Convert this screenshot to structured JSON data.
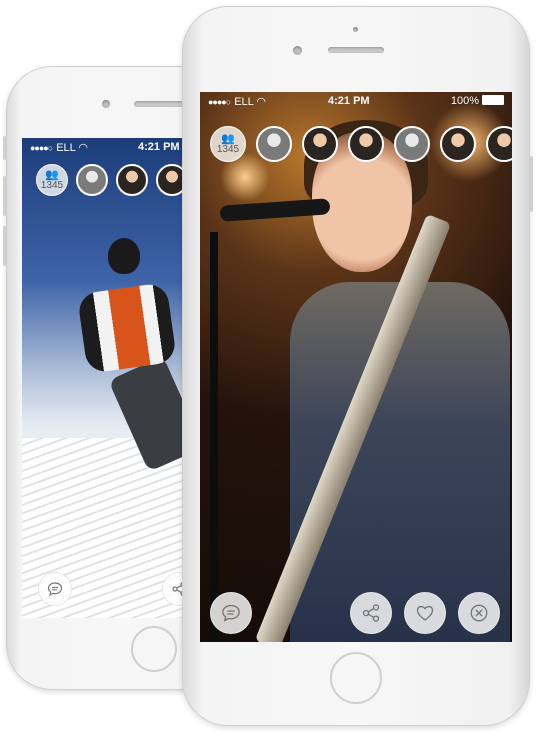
{
  "back_phone": {
    "status": {
      "carrier": "ELL",
      "time": "4:21 PM"
    },
    "viewers": {
      "count": "1345",
      "icon": "group-icon"
    },
    "avatars": [
      "avatar-1",
      "avatar-2",
      "avatar-3"
    ],
    "actions": {
      "chat_icon": "chat-icon",
      "share_icon": "share-icon"
    }
  },
  "front_phone": {
    "status": {
      "carrier": "ELL",
      "time": "4:21 PM",
      "battery": "100%"
    },
    "viewers": {
      "count": "1345",
      "icon": "group-icon"
    },
    "avatars": [
      "avatar-1",
      "avatar-2",
      "avatar-3",
      "avatar-4",
      "avatar-5",
      "avatar-6"
    ],
    "actions": {
      "chat_icon": "chat-icon",
      "share_icon": "share-icon",
      "like_icon": "heart-icon",
      "close_icon": "close-icon"
    }
  },
  "colors": {
    "accent": "#ffffff",
    "button_bg": "#f2f2f2",
    "icon": "#777777"
  }
}
